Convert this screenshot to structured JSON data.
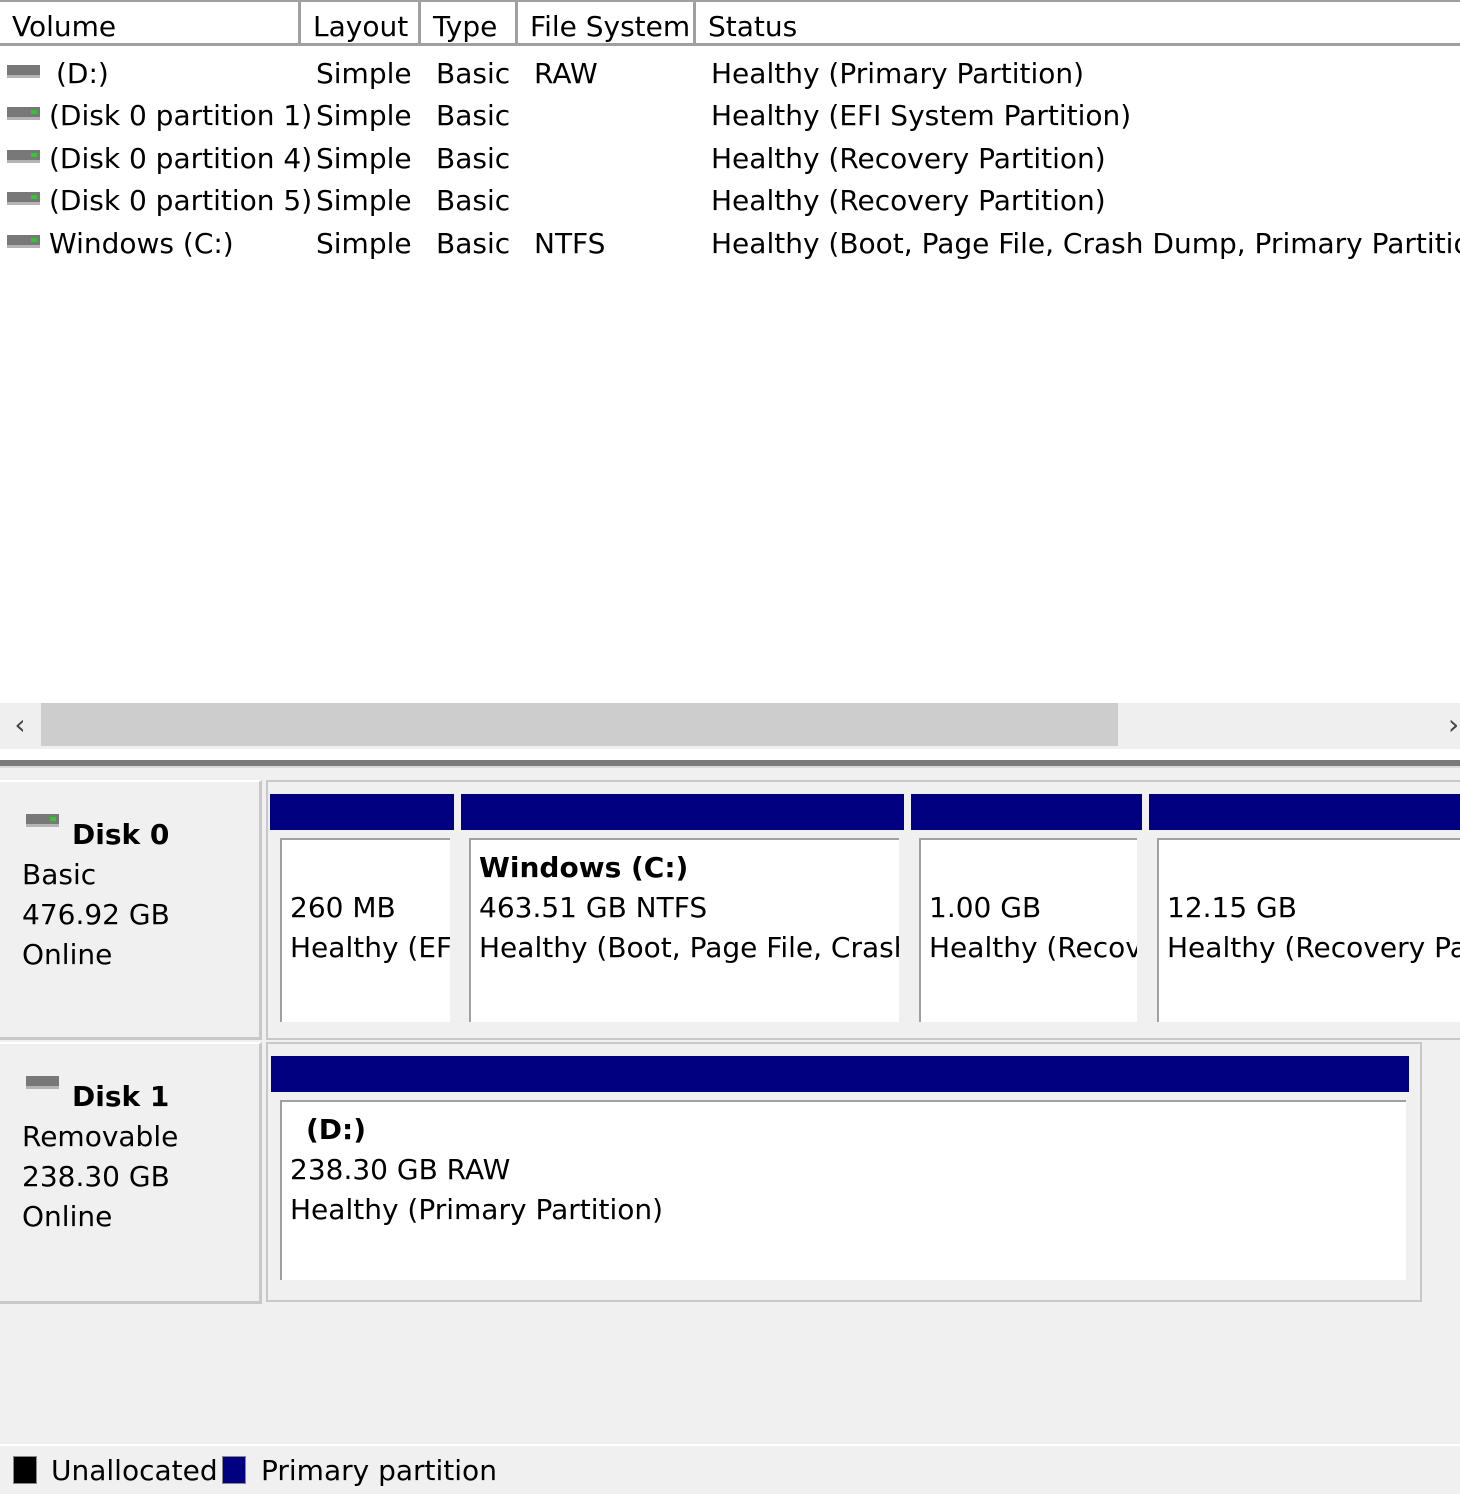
{
  "volume_list": {
    "columns": [
      "Volume",
      "Layout",
      "Type",
      "File System",
      "Status"
    ],
    "rows": [
      {
        "volume": "(D:)",
        "layout": "Simple",
        "type": "Basic",
        "fs": "RAW",
        "status": "Healthy (Primary Partition)",
        "icon": "removable-drive-icon"
      },
      {
        "volume": "(Disk 0 partition 1)",
        "layout": "Simple",
        "type": "Basic",
        "fs": "",
        "status": "Healthy (EFI System Partition)",
        "icon": "drive-icon"
      },
      {
        "volume": "(Disk 0 partition 4)",
        "layout": "Simple",
        "type": "Basic",
        "fs": "",
        "status": "Healthy (Recovery Partition)",
        "icon": "drive-icon"
      },
      {
        "volume": "(Disk 0 partition 5)",
        "layout": "Simple",
        "type": "Basic",
        "fs": "",
        "status": "Healthy (Recovery Partition)",
        "icon": "drive-icon"
      },
      {
        "volume": "Windows (C:)",
        "layout": "Simple",
        "type": "Basic",
        "fs": "NTFS",
        "status": "Healthy (Boot, Page File, Crash Dump, Primary Partition)",
        "icon": "drive-icon"
      }
    ]
  },
  "scrollbar": {
    "left_glyph": "‹",
    "right_glyph": "›"
  },
  "disks": [
    {
      "name": "Disk 0",
      "kind": "Basic",
      "size": "476.92 GB",
      "state": "Online",
      "partitions": [
        {
          "title": "",
          "size": "260 MB",
          "status": "Healthy (EF"
        },
        {
          "title": "Windows  (C:)",
          "size": "463.51 GB NTFS",
          "status": "Healthy (Boot, Page File, Crash"
        },
        {
          "title": "",
          "size": "1.00 GB",
          "status": "Healthy (Recov"
        },
        {
          "title": "",
          "size": "12.15 GB",
          "status": "Healthy (Recovery Par"
        }
      ]
    },
    {
      "name": "Disk 1",
      "kind": "Removable",
      "size": "238.30 GB",
      "state": "Online",
      "partitions": [
        {
          "title": "(D:)",
          "size": "238.30 GB RAW",
          "status": "Healthy (Primary Partition)"
        }
      ]
    }
  ],
  "legend": [
    {
      "label": "Unallocated",
      "color": "#000000"
    },
    {
      "label": "Primary partition",
      "color": "#000080"
    }
  ],
  "colors": {
    "primary_partition": "#000080",
    "unallocated": "#000000"
  }
}
